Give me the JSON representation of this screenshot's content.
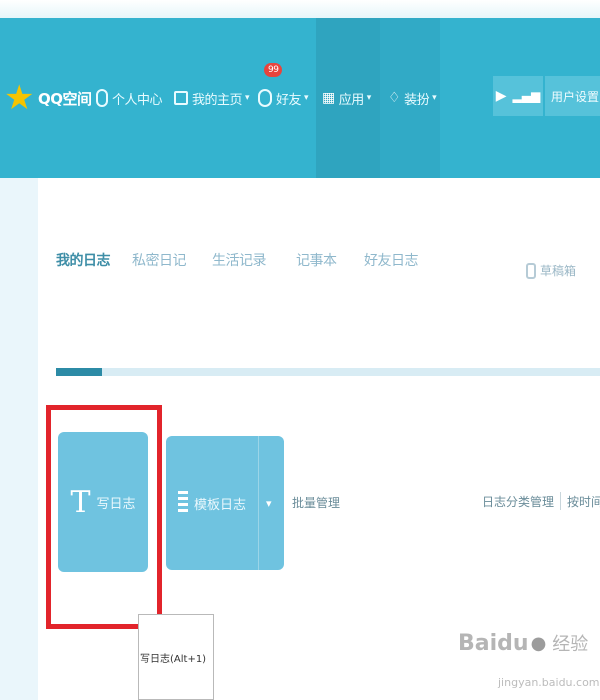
{
  "colors": {
    "topbar": "#34b3cf",
    "accent": "#2c8ba6",
    "button": "#6fc3e0",
    "highlight": "#e2242b",
    "badge": "#e8443d"
  },
  "topnav": {
    "brand": "QQ空间",
    "personal_center": "个人中心",
    "my_homepage": "我的主页",
    "friends": "好友",
    "friends_badge": "99",
    "apps": "应用",
    "decorate": "装扮",
    "user_settings": "用户设置"
  },
  "tabs": [
    {
      "label": "我的日志",
      "active": true
    },
    {
      "label": "私密日记"
    },
    {
      "label": "生活记录"
    },
    {
      "label": "记事本"
    },
    {
      "label": "好友日志"
    }
  ],
  "recycle_bin": "草稿箱",
  "toolbar": {
    "write_blog": "写日志",
    "template_blog": "模板日志",
    "batch_manage": "批量管理",
    "link1": "日志分类管理",
    "link2": "按时间归档"
  },
  "tooltip": "写日志(Alt+1)",
  "watermark": {
    "main": "Baidu",
    "cn": "经验",
    "sub": "jingyan.baidu.com"
  }
}
